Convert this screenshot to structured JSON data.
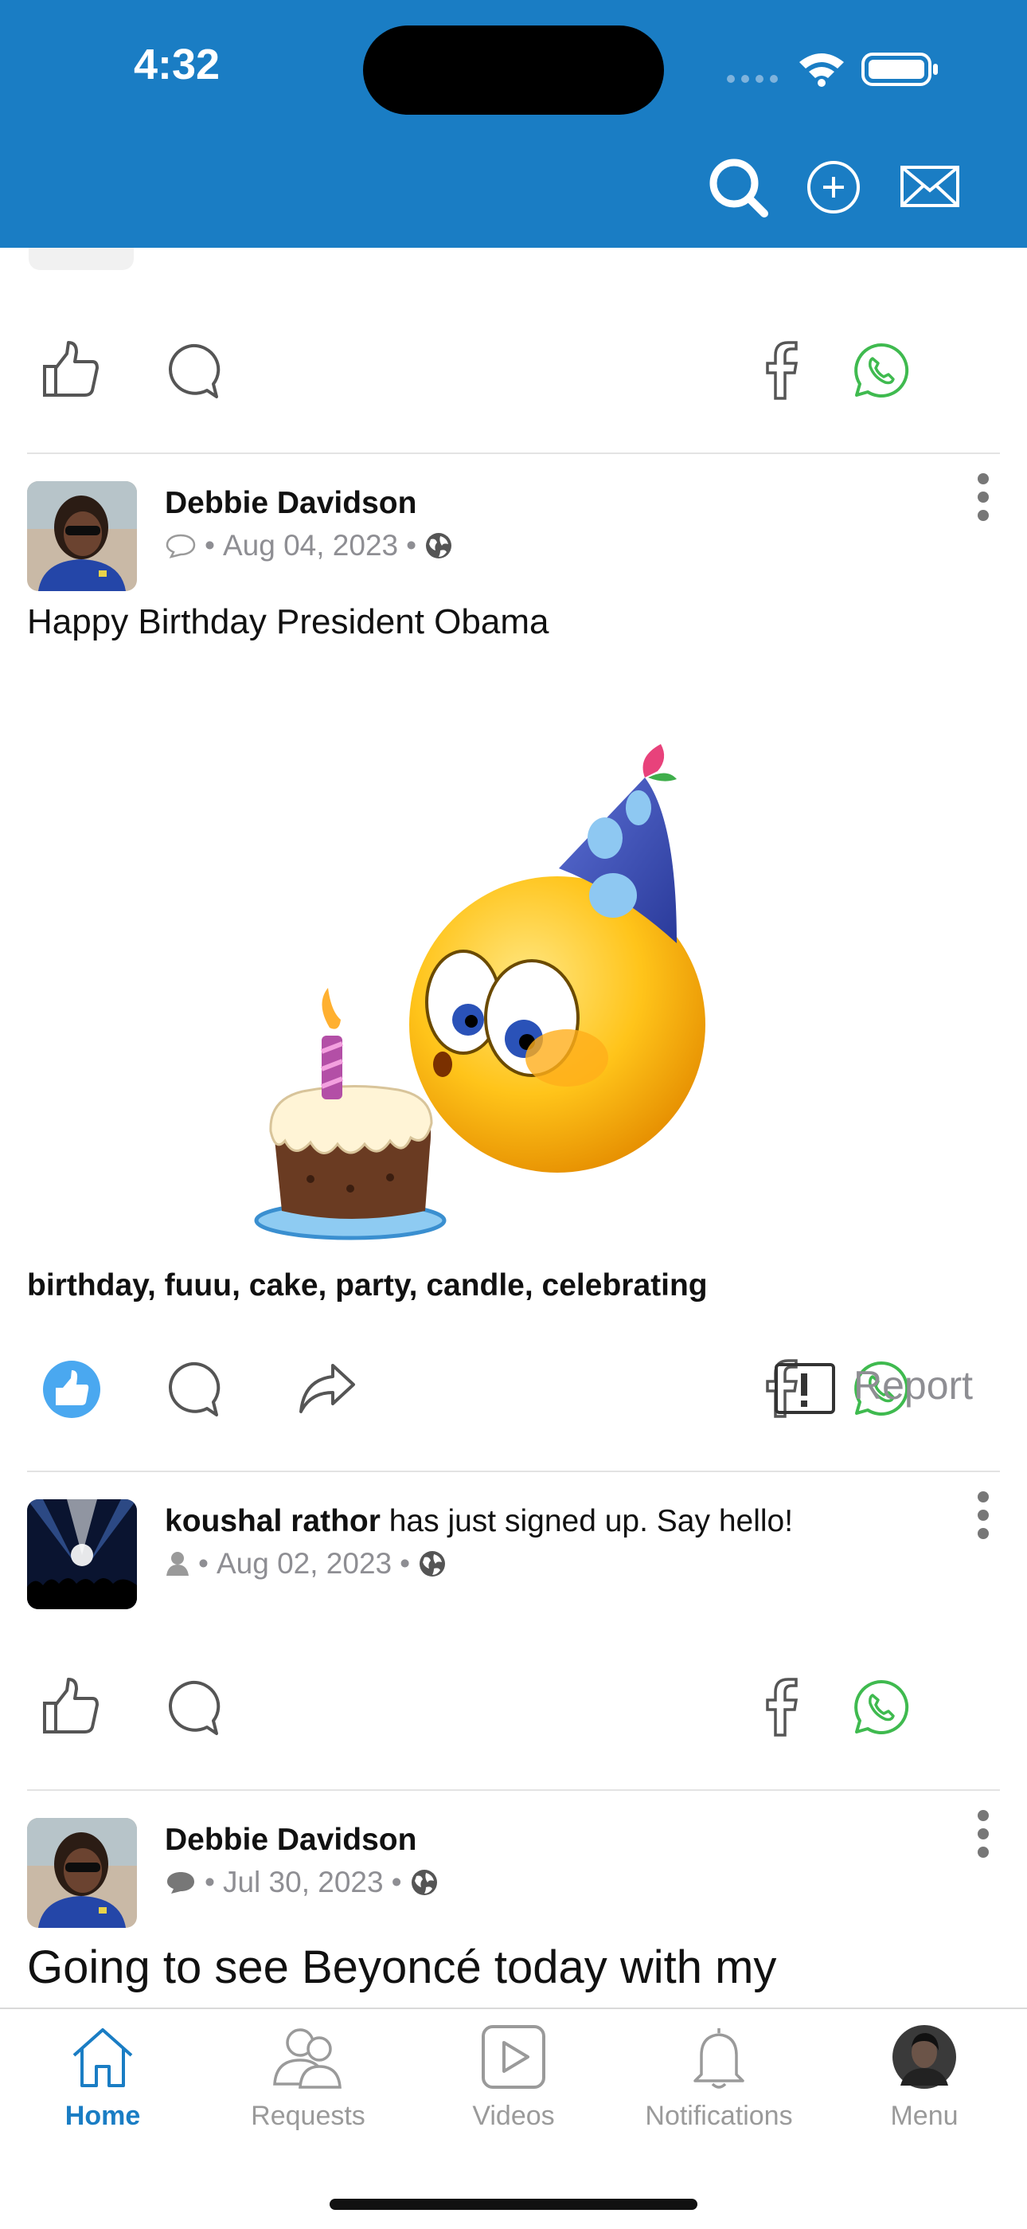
{
  "status_bar": {
    "time": "4:32"
  },
  "header": {
    "icons": [
      "search-icon",
      "add-icon",
      "messages-icon"
    ],
    "background": "#1a7dc4"
  },
  "posts": [
    {
      "author": "Debbie Davidson",
      "date": "Aug 04, 2023",
      "text": "Happy Birthday President Obama",
      "tags": "birthday, fuuu, cake, party, candle, celebrating",
      "liked": true,
      "report_label": "Report"
    },
    {
      "author": "koushal rathor",
      "action_text": "has just signed up. Say hello!",
      "date": "Aug 02, 2023"
    },
    {
      "author": "Debbie Davidson",
      "date": "Jul 30, 2023",
      "text": "Going to see Beyoncé today with my"
    }
  ],
  "meta_separator": "•",
  "tabbar": {
    "tabs": [
      {
        "label": "Home",
        "icon": "home-icon",
        "active": true
      },
      {
        "label": "Requests",
        "icon": "requests-icon",
        "active": false
      },
      {
        "label": "Videos",
        "icon": "videos-icon",
        "active": false
      },
      {
        "label": "Notifications",
        "icon": "bell-icon",
        "active": false
      },
      {
        "label": "Menu",
        "icon": "profile-avatar",
        "active": false
      }
    ]
  },
  "colors": {
    "accent": "#1a7dc4",
    "like_active": "#4aa8f0",
    "whatsapp": "#3fba4f",
    "muted": "#8e8e93"
  }
}
